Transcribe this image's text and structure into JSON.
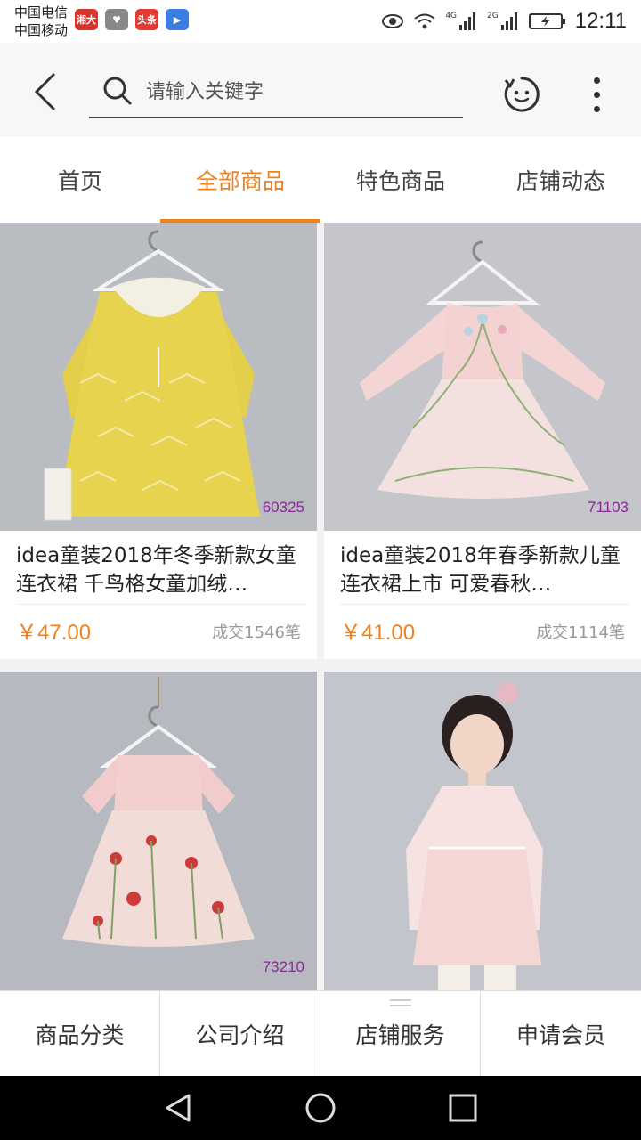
{
  "status_bar": {
    "carrier_1": "中国电信",
    "carrier_2": "中国移动",
    "notifications": [
      {
        "icon": "news-app-icon",
        "label": "湘大",
        "color": "#d8352a"
      },
      {
        "icon": "health-app-icon",
        "label": "♥",
        "color": "#888888"
      },
      {
        "icon": "toutiao-app-icon",
        "label": "头条",
        "color": "#e33b32"
      },
      {
        "icon": "video-app-icon",
        "label": "▶",
        "color": "#3b7de3"
      }
    ],
    "network_1": "4G",
    "network_2": "2G",
    "time": "12:11"
  },
  "top_bar": {
    "back_icon": "chevron-left-icon",
    "search_placeholder": "请输入关键字",
    "search_value": "",
    "message_icon": "chat-icon",
    "more_icon": "more-vertical-icon"
  },
  "tabs": [
    {
      "label": "首页",
      "active": false
    },
    {
      "label": "全部商品",
      "active": true
    },
    {
      "label": "特色商品",
      "active": false
    },
    {
      "label": "店铺动态",
      "active": false
    }
  ],
  "accent_color": "#f0821e",
  "products": [
    {
      "image": "yellow-long-sleeve-dress",
      "code": "60325",
      "title": "idea童装2018年冬季新款女童连衣裙  千鸟格女童加绒…",
      "price": "￥47.00",
      "sold": "成交1546笔"
    },
    {
      "image": "pink-tulle-dress",
      "code": "71103",
      "title": "idea童装2018年春季新款儿童连衣裙上市  可爱春秋…",
      "price": "￥41.00",
      "sold": "成交1114笔"
    },
    {
      "image": "pink-floral-embroidered-dress",
      "code": "73210",
      "title": "",
      "price": "",
      "sold": ""
    },
    {
      "image": "girl-in-pink-lace-dress",
      "code": "",
      "title": "",
      "price": "",
      "sold": ""
    }
  ],
  "bottom_nav": [
    {
      "label": "商品分类"
    },
    {
      "label": "公司介绍"
    },
    {
      "label": "店铺服务"
    },
    {
      "label": "申请会员"
    }
  ],
  "system_nav": [
    "back-triangle-icon",
    "home-circle-icon",
    "recents-square-icon"
  ]
}
